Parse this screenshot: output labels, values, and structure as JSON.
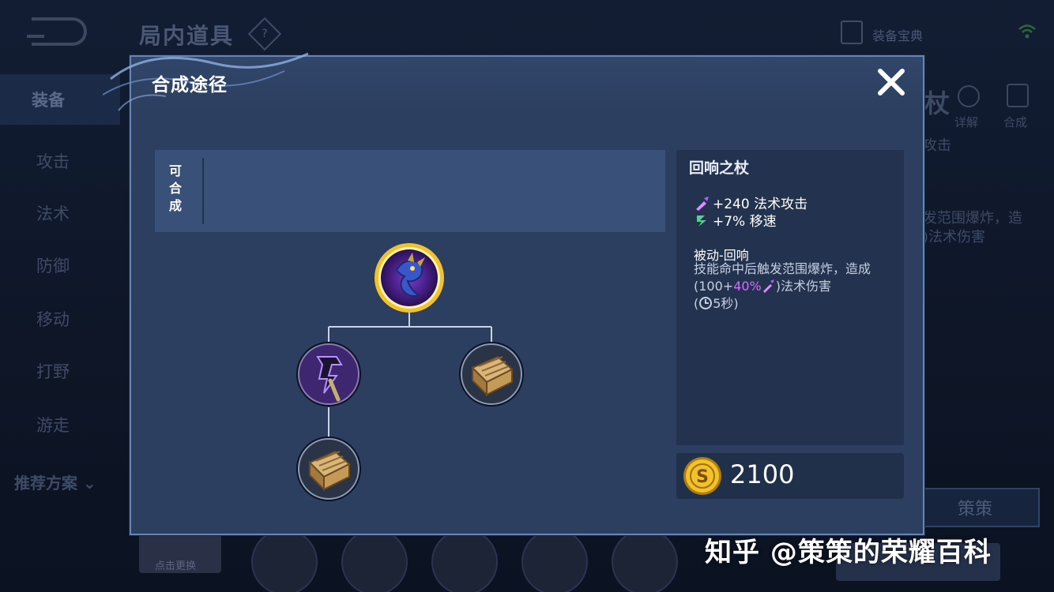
{
  "background": {
    "screen_title": "局内道具",
    "help_glyph": "?",
    "equipment_book_label": "装备宝典",
    "sidebar_items": [
      {
        "label": "装备",
        "active": true
      },
      {
        "label": "攻击",
        "active": false
      },
      {
        "label": "法术",
        "active": false
      },
      {
        "label": "防御",
        "active": false
      },
      {
        "label": "移动",
        "active": false
      },
      {
        "label": "打野",
        "active": false
      },
      {
        "label": "游走",
        "active": false
      }
    ],
    "recommend_label": "推荐方案",
    "right_glyph": "杖",
    "detail_label": "详解",
    "combine_label": "合成",
    "right_text_1": "攻击",
    "right_text_2": "发范围爆炸，造",
    "right_text_3": ")法术伤害",
    "build_name_button": "策策",
    "thumb_label": "点击更换"
  },
  "modal": {
    "title": "合成途径",
    "composable_label": "可合成",
    "tree": {
      "root": {
        "name": "回响之杖",
        "icon": "echo-staff-icon"
      },
      "children": [
        {
          "name": "component-staff",
          "icon": "purple-staff-icon",
          "children": [
            {
              "name": "component-book",
              "icon": "book-icon"
            }
          ]
        },
        {
          "name": "component-book",
          "icon": "book-icon",
          "children": []
        }
      ]
    },
    "item": {
      "name": "回响之杖",
      "stats": [
        {
          "icon": "magic-attack-icon",
          "text": "+240 法术攻击"
        },
        {
          "icon": "move-speed-icon",
          "text": "+7% 移速"
        }
      ],
      "passive_title": "被动-回响",
      "passive_desc_1": "技能命中后触发范围爆炸，造成(100+",
      "passive_desc_highlight": "40%",
      "passive_desc_2": ")法术伤害",
      "passive_cooldown_open": "(",
      "passive_cooldown": "5秒)",
      "price": "2100"
    }
  },
  "watermark": "知乎 @策策的荣耀百科",
  "colors": {
    "modal_bg": "#2c3f60",
    "modal_border": "#6584b8",
    "highlight_purple": "#d86bff",
    "gold": "#f2c12e",
    "stat_green": "#54d18a"
  }
}
